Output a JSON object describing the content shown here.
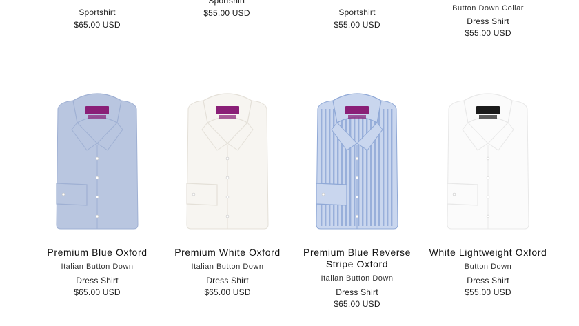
{
  "top_row": [
    {
      "lines": [
        "Sportshirt",
        "$65.00 USD"
      ]
    },
    {
      "lines": [
        "Sportshirt",
        "$55.00 USD"
      ]
    },
    {
      "lines": [
        "Sportshirt",
        "$55.00 USD"
      ]
    },
    {
      "lines": [
        "Button Down Collar",
        "Dress Shirt",
        "$55.00 USD"
      ]
    }
  ],
  "products": [
    {
      "name": "Premium Blue Oxford",
      "collar": "Italian Button Down",
      "type": "Dress Shirt",
      "price": "$65.00 USD",
      "colors": {
        "body": "#b9c6e0",
        "shade": "#9fb0d3",
        "label": "#8a1f77"
      }
    },
    {
      "name": "Premium White Oxford",
      "collar": "Italian Button Down",
      "type": "Dress Shirt",
      "price": "$65.00 USD",
      "colors": {
        "body": "#f7f5f1",
        "shade": "#e4e0d8",
        "label": "#8a1f77"
      }
    },
    {
      "name": "Premium Blue Reverse Stripe Oxford",
      "collar": "Italian Button Down",
      "type": "Dress Shirt",
      "price": "$65.00 USD",
      "colors": {
        "body": "#c9d6ee",
        "shade": "#8fa8d6",
        "label": "#8a1f77"
      }
    },
    {
      "name": "White Lightweight Oxford",
      "collar": "Button Down",
      "type": "Dress Shirt",
      "price": "$55.00 USD",
      "colors": {
        "body": "#fbfbfb",
        "shade": "#e8e8e8",
        "label": "#1b1b1b"
      }
    }
  ]
}
